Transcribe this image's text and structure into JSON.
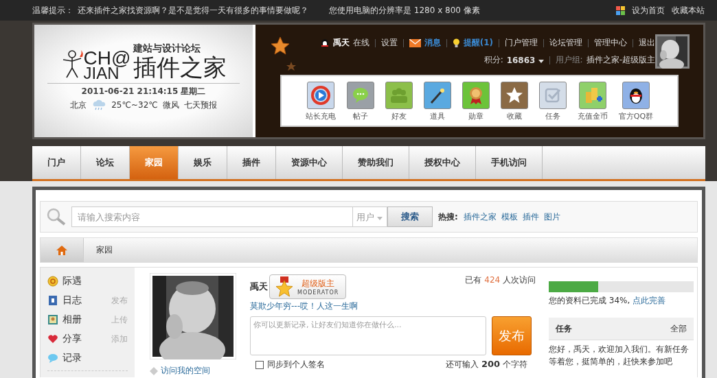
{
  "top_bar": {
    "notice_label": "温馨提示：",
    "notice": "还来插件之家找资源啊？是不是觉得一天有很多的事情要做呢？",
    "resolution": "您使用电脑的分辨率是 1280 x 800 像素",
    "links": [
      "设为首页",
      "收藏本站"
    ]
  },
  "logo": {
    "letters_top": "CH@",
    "letters_bottom": "JIAN",
    "subtitle": "建站与设计论坛",
    "title": "插件之家"
  },
  "date": "2011-06-21 21:14:15 星期二",
  "weather": {
    "city": "北京",
    "temp": "25℃~32℃",
    "wind": "微风",
    "forecast": "七天预报"
  },
  "user_bar": {
    "username": "禹天",
    "status": "在线",
    "links": [
      {
        "label": "设置",
        "kind": "plain"
      },
      {
        "label": "消息",
        "kind": "message"
      },
      {
        "label": "提醒(1)",
        "kind": "alert"
      },
      {
        "label": "门户管理",
        "kind": "plain"
      },
      {
        "label": "论坛管理",
        "kind": "plain"
      },
      {
        "label": "管理中心",
        "kind": "plain"
      },
      {
        "label": "退出",
        "kind": "plain"
      }
    ],
    "points_label": "积分:",
    "points": "16863",
    "group_label": "用户组:",
    "group": "插件之家-超级版主"
  },
  "quick_icons": [
    {
      "label": "站长充电",
      "kind": "play"
    },
    {
      "label": "帖子",
      "kind": "chat"
    },
    {
      "label": "好友",
      "kind": "friends"
    },
    {
      "label": "道具",
      "kind": "wand"
    },
    {
      "label": "勋章",
      "kind": "medal"
    },
    {
      "label": "收藏",
      "kind": "star"
    },
    {
      "label": "任务",
      "kind": "task"
    },
    {
      "label": "充值金币",
      "kind": "coins"
    },
    {
      "label": "官方QQ群",
      "kind": "penguin"
    }
  ],
  "nav": {
    "tabs": [
      {
        "label": "门户",
        "selected": false
      },
      {
        "label": "论坛",
        "selected": false
      },
      {
        "label": "家园",
        "selected": true
      },
      {
        "label": "娱乐",
        "selected": false
      },
      {
        "label": "插件",
        "selected": false
      },
      {
        "label": "资源中心",
        "selected": false
      },
      {
        "label": "赞助我们",
        "selected": false
      },
      {
        "label": "授权中心",
        "selected": false
      },
      {
        "label": "手机访问",
        "selected": false
      }
    ]
  },
  "search": {
    "placeholder": "请输入搜索内容",
    "scope": "用户",
    "button": "搜索",
    "hot_label": "热搜:",
    "hot": [
      "插件之家",
      "模板",
      "插件",
      "图片"
    ]
  },
  "breadcrumb": "家园",
  "sidebar": {
    "items": [
      {
        "label": "际遇",
        "kind": "coin"
      },
      {
        "label": "日志",
        "action": "发布",
        "kind": "blog"
      },
      {
        "label": "相册",
        "action": "上传",
        "kind": "album"
      },
      {
        "label": "分享",
        "action": "添加",
        "kind": "heart"
      },
      {
        "label": "记录",
        "kind": "bubble"
      }
    ]
  },
  "profile": {
    "name": "禹天",
    "badge_title": "超级版主",
    "badge_sub": "MODERATOR",
    "motto": "莫欺少年穷---哎！人这一生啊",
    "visits_prefix": "已有",
    "visits": "424",
    "visits_suffix": "人次访问",
    "status_placeholder": "你可以更新记录, 让好友们知道你在做什么...",
    "publish": "发布",
    "sync": {
      "label": "同步到个人签名",
      "checked": false
    },
    "remaining_prefix": "还可输入",
    "remaining": "200",
    "remaining_suffix": "个字符",
    "visit_link": "访问我的空间"
  },
  "completion": {
    "level": 0.34,
    "text": "您的资料已完成 34%,",
    "link": "点此完善"
  },
  "tasks": {
    "title": "任务",
    "all": "全部",
    "text": "您好，禹天，欢迎加入我们。有新任务等着您，挺简单的，赶快来参加吧"
  }
}
